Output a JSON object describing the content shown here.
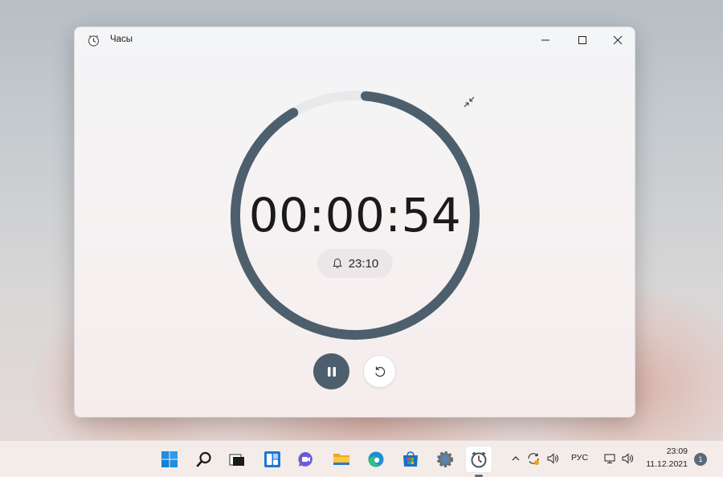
{
  "window": {
    "title": "Часы",
    "controls": [
      "minimize-icon",
      "maximize-icon",
      "close-icon"
    ]
  },
  "timer": {
    "time": "00:00:54",
    "alarm_time": "23:10",
    "progress_remaining_fraction": 0.9,
    "ring_color": "#4d5f6c",
    "track_color": "#e9e9eb"
  },
  "controls": {
    "pause_icon": "pause-icon",
    "reset_icon": "reset-icon",
    "collapse_icon": "collapse-icon"
  },
  "taskbar": {
    "apps": [
      "windows-start-icon",
      "search-icon",
      "task-view-icon",
      "widgets-icon",
      "chat-icon",
      "file-explorer-icon",
      "edge-icon",
      "store-icon",
      "settings-icon",
      "clock-app-icon"
    ],
    "language": "РУС",
    "clock_time": "23:09",
    "clock_date": "11.12.2021",
    "notifications": "1"
  }
}
